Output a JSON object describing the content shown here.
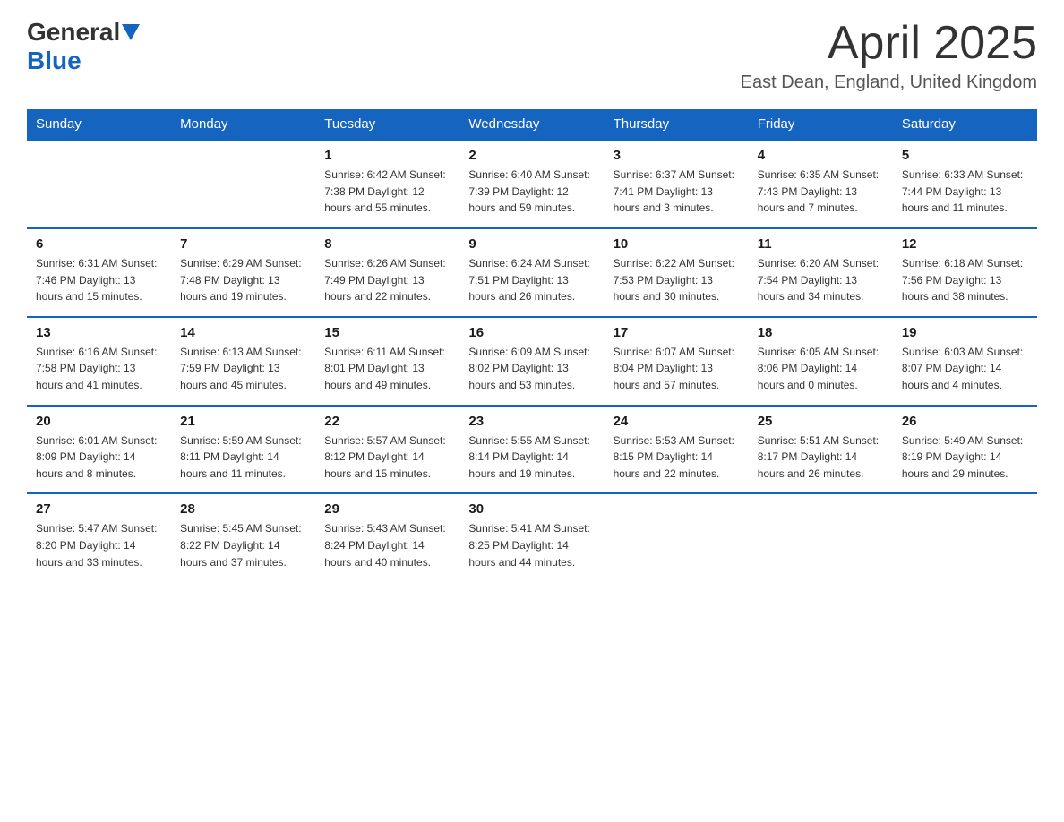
{
  "logo": {
    "general": "General",
    "blue": "Blue"
  },
  "title": "April 2025",
  "subtitle": "East Dean, England, United Kingdom",
  "weekdays": [
    "Sunday",
    "Monday",
    "Tuesday",
    "Wednesday",
    "Thursday",
    "Friday",
    "Saturday"
  ],
  "weeks": [
    [
      {
        "day": "",
        "info": ""
      },
      {
        "day": "",
        "info": ""
      },
      {
        "day": "1",
        "info": "Sunrise: 6:42 AM\nSunset: 7:38 PM\nDaylight: 12 hours\nand 55 minutes."
      },
      {
        "day": "2",
        "info": "Sunrise: 6:40 AM\nSunset: 7:39 PM\nDaylight: 12 hours\nand 59 minutes."
      },
      {
        "day": "3",
        "info": "Sunrise: 6:37 AM\nSunset: 7:41 PM\nDaylight: 13 hours\nand 3 minutes."
      },
      {
        "day": "4",
        "info": "Sunrise: 6:35 AM\nSunset: 7:43 PM\nDaylight: 13 hours\nand 7 minutes."
      },
      {
        "day": "5",
        "info": "Sunrise: 6:33 AM\nSunset: 7:44 PM\nDaylight: 13 hours\nand 11 minutes."
      }
    ],
    [
      {
        "day": "6",
        "info": "Sunrise: 6:31 AM\nSunset: 7:46 PM\nDaylight: 13 hours\nand 15 minutes."
      },
      {
        "day": "7",
        "info": "Sunrise: 6:29 AM\nSunset: 7:48 PM\nDaylight: 13 hours\nand 19 minutes."
      },
      {
        "day": "8",
        "info": "Sunrise: 6:26 AM\nSunset: 7:49 PM\nDaylight: 13 hours\nand 22 minutes."
      },
      {
        "day": "9",
        "info": "Sunrise: 6:24 AM\nSunset: 7:51 PM\nDaylight: 13 hours\nand 26 minutes."
      },
      {
        "day": "10",
        "info": "Sunrise: 6:22 AM\nSunset: 7:53 PM\nDaylight: 13 hours\nand 30 minutes."
      },
      {
        "day": "11",
        "info": "Sunrise: 6:20 AM\nSunset: 7:54 PM\nDaylight: 13 hours\nand 34 minutes."
      },
      {
        "day": "12",
        "info": "Sunrise: 6:18 AM\nSunset: 7:56 PM\nDaylight: 13 hours\nand 38 minutes."
      }
    ],
    [
      {
        "day": "13",
        "info": "Sunrise: 6:16 AM\nSunset: 7:58 PM\nDaylight: 13 hours\nand 41 minutes."
      },
      {
        "day": "14",
        "info": "Sunrise: 6:13 AM\nSunset: 7:59 PM\nDaylight: 13 hours\nand 45 minutes."
      },
      {
        "day": "15",
        "info": "Sunrise: 6:11 AM\nSunset: 8:01 PM\nDaylight: 13 hours\nand 49 minutes."
      },
      {
        "day": "16",
        "info": "Sunrise: 6:09 AM\nSunset: 8:02 PM\nDaylight: 13 hours\nand 53 minutes."
      },
      {
        "day": "17",
        "info": "Sunrise: 6:07 AM\nSunset: 8:04 PM\nDaylight: 13 hours\nand 57 minutes."
      },
      {
        "day": "18",
        "info": "Sunrise: 6:05 AM\nSunset: 8:06 PM\nDaylight: 14 hours\nand 0 minutes."
      },
      {
        "day": "19",
        "info": "Sunrise: 6:03 AM\nSunset: 8:07 PM\nDaylight: 14 hours\nand 4 minutes."
      }
    ],
    [
      {
        "day": "20",
        "info": "Sunrise: 6:01 AM\nSunset: 8:09 PM\nDaylight: 14 hours\nand 8 minutes."
      },
      {
        "day": "21",
        "info": "Sunrise: 5:59 AM\nSunset: 8:11 PM\nDaylight: 14 hours\nand 11 minutes."
      },
      {
        "day": "22",
        "info": "Sunrise: 5:57 AM\nSunset: 8:12 PM\nDaylight: 14 hours\nand 15 minutes."
      },
      {
        "day": "23",
        "info": "Sunrise: 5:55 AM\nSunset: 8:14 PM\nDaylight: 14 hours\nand 19 minutes."
      },
      {
        "day": "24",
        "info": "Sunrise: 5:53 AM\nSunset: 8:15 PM\nDaylight: 14 hours\nand 22 minutes."
      },
      {
        "day": "25",
        "info": "Sunrise: 5:51 AM\nSunset: 8:17 PM\nDaylight: 14 hours\nand 26 minutes."
      },
      {
        "day": "26",
        "info": "Sunrise: 5:49 AM\nSunset: 8:19 PM\nDaylight: 14 hours\nand 29 minutes."
      }
    ],
    [
      {
        "day": "27",
        "info": "Sunrise: 5:47 AM\nSunset: 8:20 PM\nDaylight: 14 hours\nand 33 minutes."
      },
      {
        "day": "28",
        "info": "Sunrise: 5:45 AM\nSunset: 8:22 PM\nDaylight: 14 hours\nand 37 minutes."
      },
      {
        "day": "29",
        "info": "Sunrise: 5:43 AM\nSunset: 8:24 PM\nDaylight: 14 hours\nand 40 minutes."
      },
      {
        "day": "30",
        "info": "Sunrise: 5:41 AM\nSunset: 8:25 PM\nDaylight: 14 hours\nand 44 minutes."
      },
      {
        "day": "",
        "info": ""
      },
      {
        "day": "",
        "info": ""
      },
      {
        "day": "",
        "info": ""
      }
    ]
  ]
}
